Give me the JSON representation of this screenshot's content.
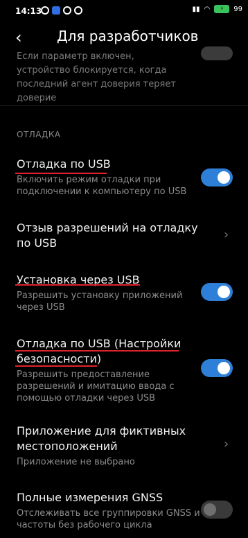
{
  "status": {
    "time": "14:13",
    "battery": "99"
  },
  "header": {
    "back": "‹",
    "title": "Для разработчиков"
  },
  "partial_item": {
    "subtitle": "Если параметр включен, устройство блокируется, когда последний агент доверия теряет доверие"
  },
  "section": {
    "title": "ОТЛАДКА"
  },
  "items": [
    {
      "title": "Отладка по USB",
      "subtitle": "Включить режим отладки при подключении к компьютеру по USB"
    },
    {
      "title": "Отзыв разрешений на отладку по USB"
    },
    {
      "title": "Установка через USB",
      "subtitle": "Разрешить установку приложений через USB"
    },
    {
      "title": "Отладка по USB (Настройки безопасности)",
      "subtitle": "Разрешить предоставление разрешений и имитацию ввода с помощью отладки через USB"
    },
    {
      "title": "Приложение для фиктивных местоположений",
      "subtitle": "Приложение не выбрано"
    },
    {
      "title": "Полные измерения GNSS",
      "subtitle": "Отслеживать все группировки GNSS и частоты без рабочего цикла"
    }
  ],
  "colors": {
    "toggle_on": "#2e7fd8",
    "underline": "#e2222c",
    "background": "#000000"
  }
}
